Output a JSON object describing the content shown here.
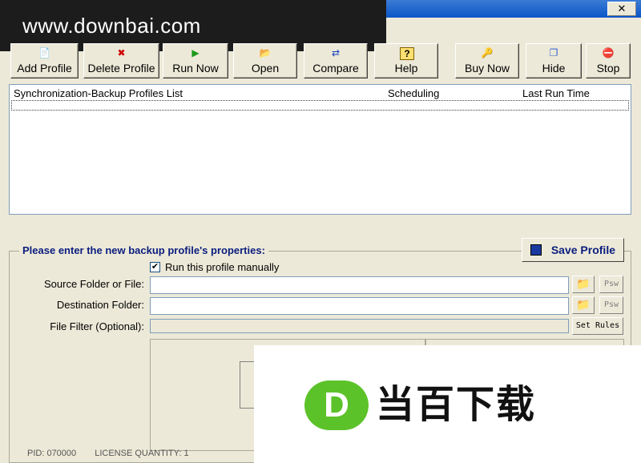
{
  "watermark": {
    "top_text": "www.downbai.com",
    "bottom_logo": "D",
    "bottom_text": "当百下载"
  },
  "window": {
    "close_label": "✕"
  },
  "toolbar": {
    "buttons": [
      {
        "label": "Add Profile",
        "icon": "new-document-icon",
        "glyph": "📄"
      },
      {
        "label": "Delete Profile",
        "icon": "delete-document-icon",
        "glyph": "✖"
      },
      {
        "label": "Run Now",
        "icon": "play-icon",
        "glyph": "▶"
      },
      {
        "label": "Open",
        "icon": "folder-open-icon",
        "glyph": "📂"
      },
      {
        "label": "Compare",
        "icon": "compare-icon",
        "glyph": "⇄"
      },
      {
        "label": "Help",
        "icon": "help-icon",
        "glyph": "?"
      },
      {
        "label": "Buy Now",
        "icon": "key-icon",
        "glyph": "🔑"
      },
      {
        "label": "Hide",
        "icon": "hide-window-icon",
        "glyph": "❐"
      },
      {
        "label": "Stop",
        "icon": "stop-icon",
        "glyph": "⛔"
      }
    ]
  },
  "profiles_list": {
    "columns": [
      "Synchronization-Backup Profiles List",
      "Scheduling",
      "Last Run Time"
    ],
    "rows": []
  },
  "form": {
    "title": "Please enter the new backup profile's properties:",
    "save_label": "Save Profile",
    "run_manually_label": "Run this profile manually",
    "run_manually_checked": "✔",
    "source_label": "Source Folder or File:",
    "destination_label": "Destination Folder:",
    "filter_label": "File Filter (Optional):",
    "psw_label": "Psw",
    "set_rules_label": "Set Rules",
    "source_value": "",
    "destination_value": "",
    "filter_value": ""
  },
  "status": {
    "pid": "PID:  070000",
    "license": "LICENSE QUANTITY:  1"
  }
}
